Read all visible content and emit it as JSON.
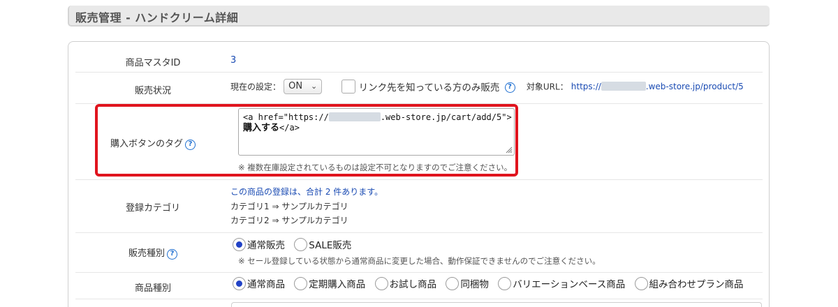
{
  "header": {
    "title": "販売管理 - ハンドクリーム詳細"
  },
  "rows": {
    "master_id": {
      "label": "商品マスタID",
      "value": "3"
    },
    "sale_status": {
      "label": "販売状況",
      "setting_label": "現在の設定：",
      "select_value": "ON",
      "checkbox_label": "リンク先を知っている方のみ販売",
      "url_label": "対象URL：",
      "url_prefix": "https://",
      "url_suffix": ".web-store.jp/product/5"
    },
    "buy_tag": {
      "label": "購入ボタンのタグ",
      "code_line1_prefix": "<a href=\"https://",
      "code_line1_suffix": ".web-store.jp/cart/add/5\">",
      "code_line2_bold": "購入する",
      "code_line2_tail": "</a>",
      "note": "※ 複数在庫設定されているものは設定不可となりますのでご注意ください。"
    },
    "category": {
      "label": "登録カテゴリ",
      "summary": "この商品の登録は、合計 2 件あります。",
      "items": [
        "カテゴリ1 ⇒ サンプルカテゴリ",
        "カテゴリ2 ⇒ サンプルカテゴリ"
      ]
    },
    "sale_type": {
      "label": "販売種別",
      "options": [
        "通常販売",
        "SALE販売"
      ],
      "selected": 0,
      "note": "※ セール登録している状態から通常商品に変更した場合、動作保証できませんのでご注意ください。"
    },
    "product_type": {
      "label": "商品種別",
      "options": [
        "通常商品",
        "定期購入商品",
        "お試し商品",
        "同梱物",
        "バリエーションベース商品",
        "組み合わせプラン商品"
      ],
      "selected": 0
    }
  },
  "colors": {
    "accent": "#1e6fd1",
    "highlight": "#e0141e",
    "radio": "#2142c6",
    "link": "#1a4bb3"
  }
}
